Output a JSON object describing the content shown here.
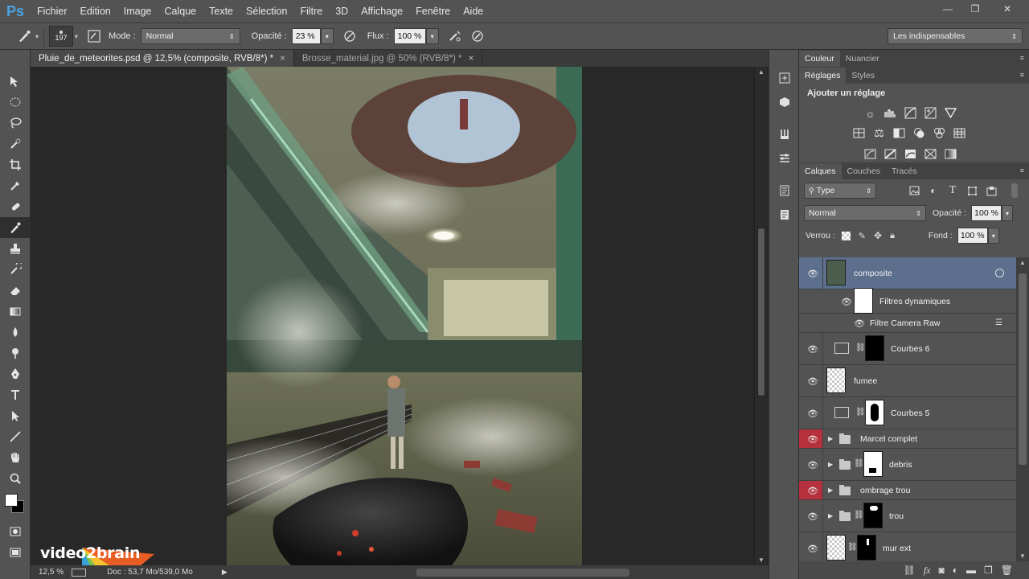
{
  "menubar": {
    "logo": "Ps",
    "items": [
      "Fichier",
      "Edition",
      "Image",
      "Calque",
      "Texte",
      "Sélection",
      "Filtre",
      "3D",
      "Affichage",
      "Fenêtre",
      "Aide"
    ],
    "win_minimize": "—",
    "win_restore": "❐",
    "win_close": "✕"
  },
  "options": {
    "brush_size": "197",
    "mode_label": "Mode :",
    "mode_value": "Normal",
    "opacity_label": "Opacité :",
    "opacity_value": "23 %",
    "flux_label": "Flux :",
    "flux_value": "100 %",
    "workspace": "Les indispensables"
  },
  "tabs": [
    {
      "label": "Pluie_de_meteorites.psd @ 12,5% (composite, RVB/8*) *",
      "close": "×"
    },
    {
      "label": "Brosse_material.jpg @ 50% (RVB/8*) *",
      "close": "×"
    }
  ],
  "status": {
    "zoom": "12,5 %",
    "doc": "Doc : 53,7 Mo/539,0 Mo",
    "arrow": "▶"
  },
  "watermark": {
    "text": "video2brain"
  },
  "panels": {
    "color_tabs": [
      "Couleur",
      "Nuancier"
    ],
    "adjust_tabs": [
      "Réglages",
      "Styles"
    ],
    "adjust_title": "Ajouter un réglage",
    "layer_tabs": [
      "Calques",
      "Couches",
      "Tracés"
    ],
    "filter_type": "Type",
    "blend_mode": "Normal",
    "opacity_label": "Opacité :",
    "opacity_value": "100 %",
    "lock_label": "Verrou :",
    "fill_label": "Fond :",
    "fill_value": "100 %"
  },
  "layers": [
    {
      "name": "composite"
    },
    {
      "name": "Filtres dynamiques"
    },
    {
      "name": "Filtre Camera Raw"
    },
    {
      "name": "Courbes 6"
    },
    {
      "name": "fumee"
    },
    {
      "name": "Courbes 5"
    },
    {
      "name": "Marcel complet"
    },
    {
      "name": "debris"
    },
    {
      "name": "ombrage trou"
    },
    {
      "name": "trou"
    },
    {
      "name": "mur ext"
    }
  ],
  "colors": {
    "ui_bg": "#535353",
    "selected_layer": "#5c6f8d",
    "group_red": "#b5313d",
    "ps_blue": "#4aa3df"
  }
}
